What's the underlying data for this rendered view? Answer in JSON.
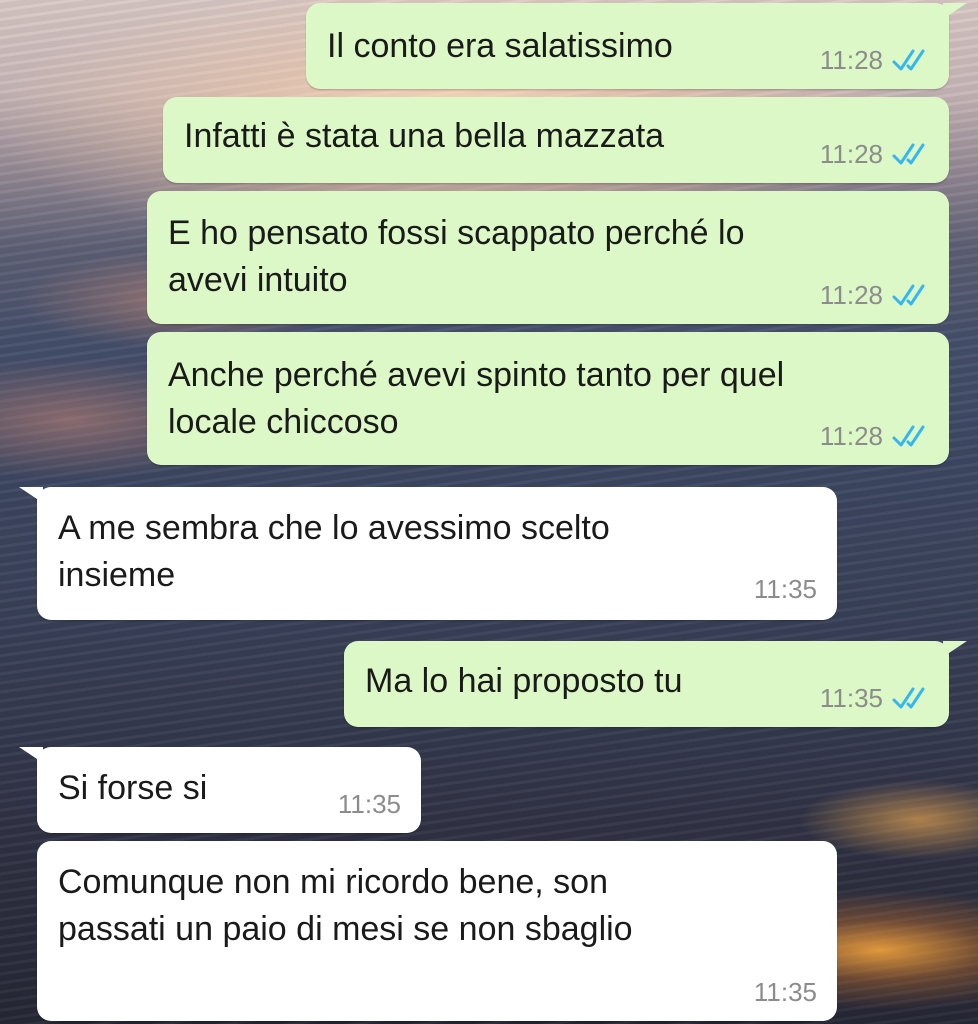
{
  "theme": {
    "outgoing_bubble": "#dcf8c6",
    "incoming_bubble": "#ffffff",
    "read_tick_color": "#34b7f1",
    "time_color": "#8c8c8c"
  },
  "messages": [
    {
      "direction": "outgoing",
      "text": "Il conto era salatissimo",
      "time": "11:28",
      "status": "read"
    },
    {
      "direction": "outgoing",
      "text": "Infatti è stata una bella mazzata",
      "time": "11:28",
      "status": "read"
    },
    {
      "direction": "outgoing",
      "text": "E ho pensato fossi scappato perché lo\navevi intuito",
      "time": "11:28",
      "status": "read"
    },
    {
      "direction": "outgoing",
      "text": "Anche perché avevi spinto tanto per quel\nlocale chiccoso",
      "time": "11:28",
      "status": "read"
    },
    {
      "direction": "incoming",
      "text": "A me sembra che lo avessimo scelto\ninsieme",
      "time": "11:35"
    },
    {
      "direction": "outgoing",
      "text": "Ma lo hai proposto tu",
      "time": "11:35",
      "status": "read"
    },
    {
      "direction": "incoming",
      "text": "Si forse si",
      "time": "11:35"
    },
    {
      "direction": "incoming",
      "text": "Comunque non mi ricordo bene, son\npassati un paio di mesi se non sbaglio",
      "time": "11:35"
    }
  ]
}
